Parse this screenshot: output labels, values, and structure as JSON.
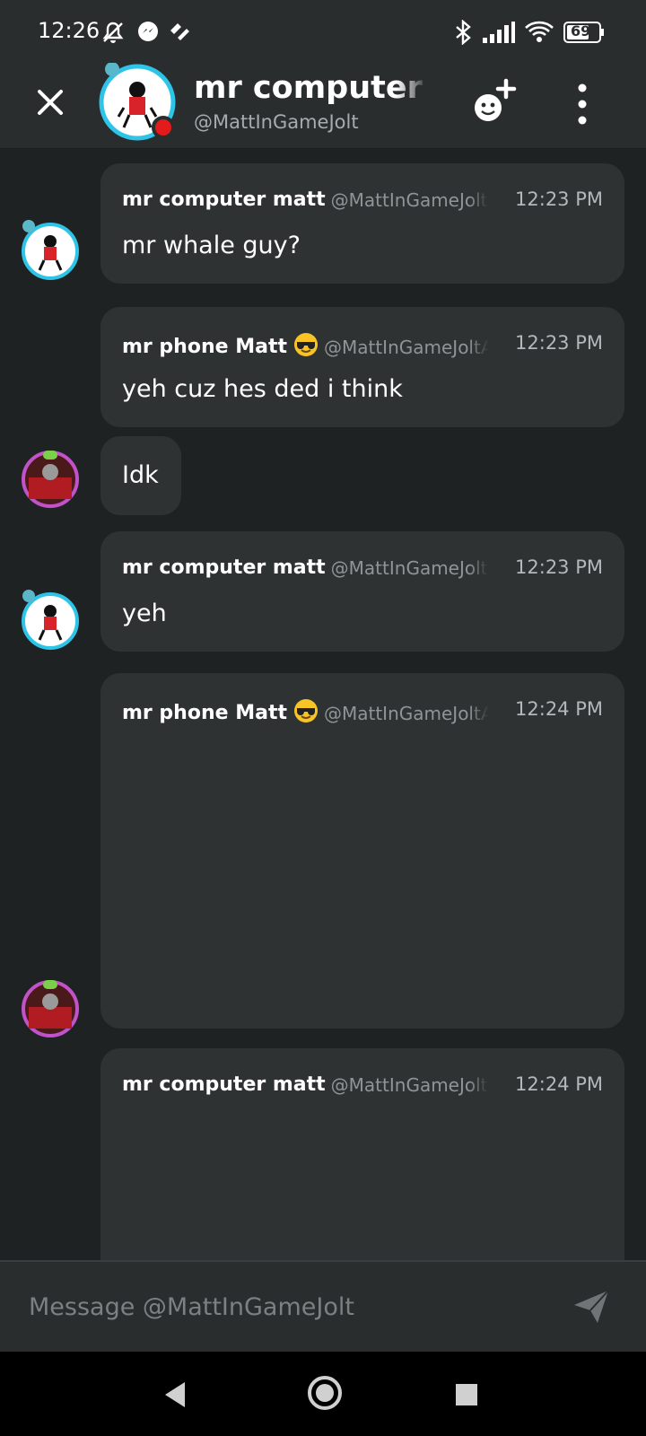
{
  "status_bar": {
    "time": "12:26",
    "battery": "69",
    "icons": [
      "mute-icon",
      "messenger-icon",
      "gamejolt-icon",
      "bluetooth-icon",
      "signal-icon",
      "wifi-icon",
      "battery-icon"
    ]
  },
  "header": {
    "name": "mr computer matt",
    "handle": "@MattInGameJolt",
    "status_color": "#e51a1a"
  },
  "messages": [
    {
      "author": "mr computer matt",
      "handle": "@MattInGameJolt",
      "time": "12:23 PM",
      "text": "mr whale guy?",
      "avatar": "computer"
    },
    {
      "author": "mr phone Matt",
      "emoji": "sunglasses",
      "handle": "@MattInGameJoltAlt",
      "time": "12:23 PM",
      "text": "yeh cuz hes ded i think",
      "avatar": "phone"
    },
    {
      "text": "Idk"
    },
    {
      "author": "mr computer matt",
      "handle": "@MattInGameJolt",
      "time": "12:23 PM",
      "text": "yeh",
      "avatar": "computer"
    },
    {
      "author": "mr phone Matt",
      "emoji": "sunglasses",
      "handle": "@MattInGameJoltAlt",
      "time": "12:24 PM",
      "text": "",
      "avatar": "phone"
    },
    {
      "author": "mr computer matt",
      "handle": "@MattInGameJolt",
      "time": "12:24 PM",
      "text": "",
      "avatar": "computer"
    }
  ],
  "input": {
    "placeholder": "Message @MattInGameJolt"
  },
  "colors": {
    "background": "#1f2223",
    "bubble": "#2f3233",
    "header": "#2a2d2e",
    "avatar_ring_computer": "#2ec4e8",
    "avatar_ring_phone": "#c152c9"
  }
}
